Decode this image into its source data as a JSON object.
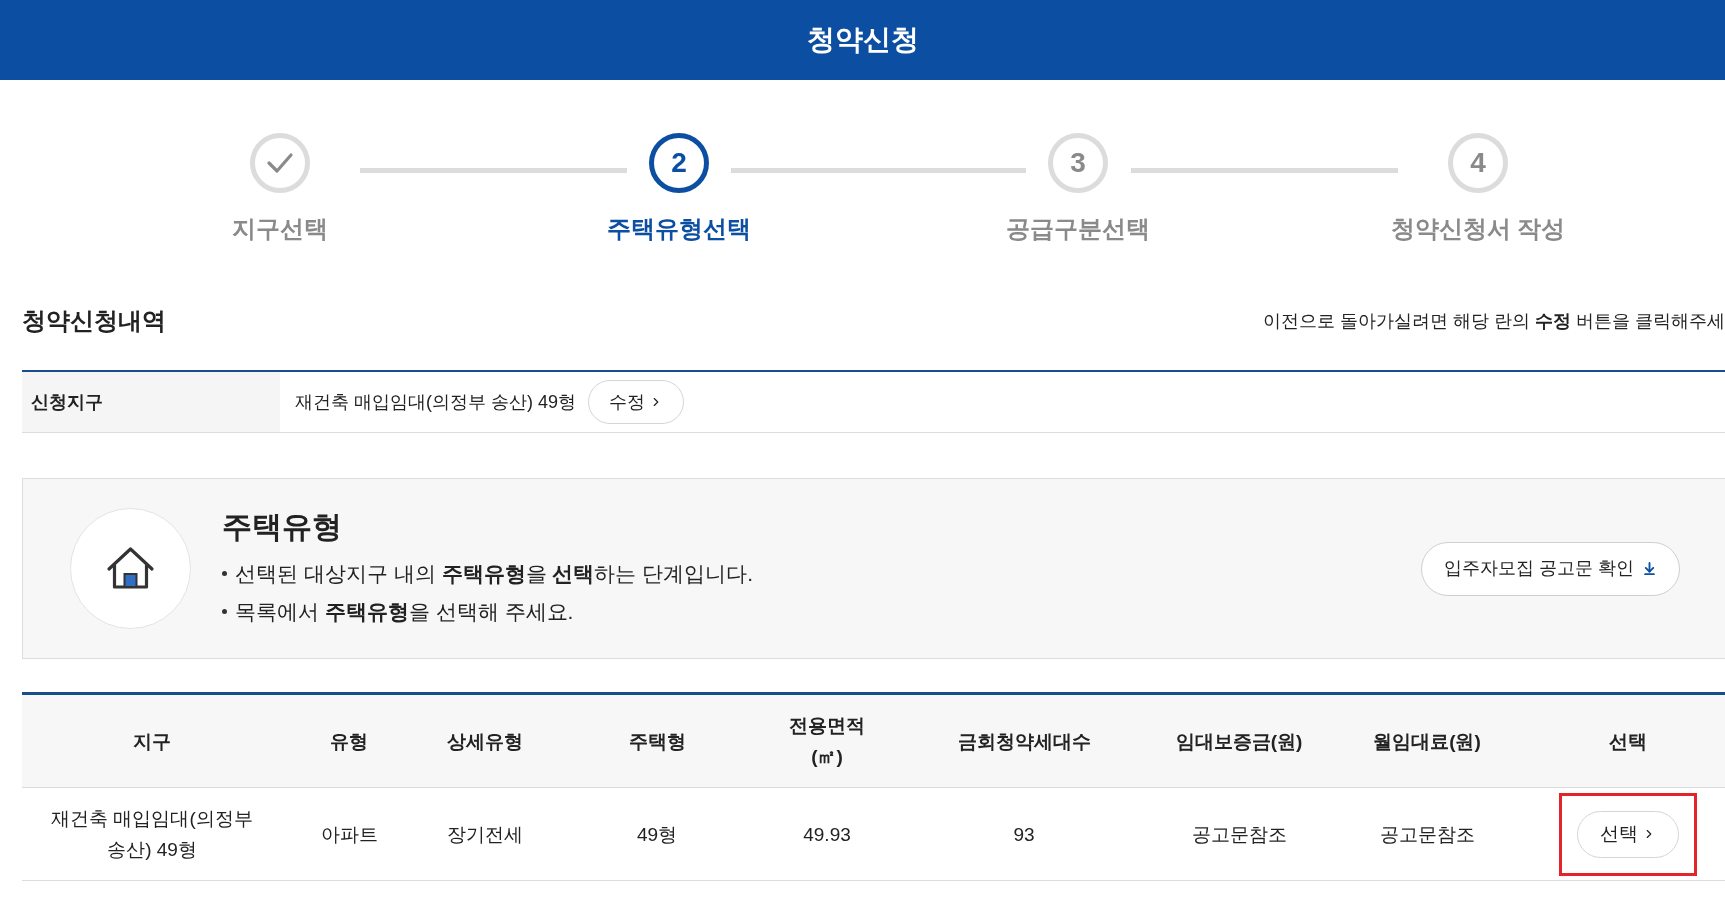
{
  "header": {
    "title": "청약신청"
  },
  "steps": [
    {
      "label": "지구선택",
      "completed": true,
      "selected": false
    },
    {
      "number": "2",
      "label": "주택유형선택",
      "completed": false,
      "selected": true
    },
    {
      "number": "3",
      "label": "공급구분선택",
      "completed": false,
      "selected": false
    },
    {
      "number": "4",
      "label": "청약신청서 작성",
      "completed": false,
      "selected": false
    }
  ],
  "summary": {
    "title": "청약신청내역",
    "hint": "이전으로 돌아가실려면 해당 란의 **수정** 버튼을 클릭해주세",
    "rows": [
      {
        "label": "신청지구",
        "value": "재건축 매입임대(의정부 송산) 49형",
        "button": "수정"
      }
    ]
  },
  "info": {
    "title": "주택유형",
    "bullets": [
      "선택된 대상지구 내의 **주택유형**을 **선택**하는 단계입니다.",
      "목록에서 **주택유형**을 선택해 주세요."
    ],
    "button": "입주자모집 공고문 확인"
  },
  "table": {
    "columns": [
      "지구",
      "유형",
      "상세유형",
      "주택형",
      "전용면적\n(㎡)",
      "금회청약세대수",
      "임대보증금(원)",
      "월임대료(원)",
      "선택"
    ],
    "rows": [
      {
        "cells": [
          "재건축 매입임대(의정부 송산) 49형",
          "아파트",
          "장기전세",
          "49형",
          "49.93",
          "93",
          "공고문참조",
          "공고문참조"
        ],
        "button": "선택",
        "highlighted": true
      }
    ]
  }
}
